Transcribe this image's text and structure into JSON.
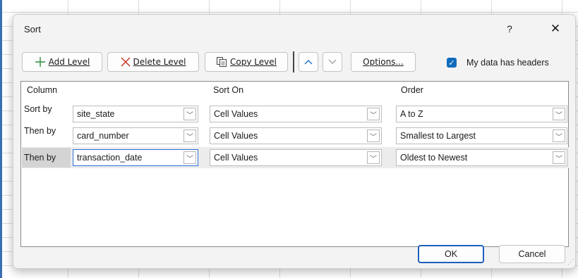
{
  "dialog": {
    "title": "Sort",
    "help_label": "?",
    "close_label": "✕"
  },
  "toolbar": {
    "add_level": "Add Level",
    "delete_level": "Delete Level",
    "copy_level": "Copy Level",
    "move_up_icon": "chevron-up",
    "move_down_icon": "chevron-down",
    "options": "Options...",
    "headers_checkbox": {
      "label": "My data has headers",
      "checked": true
    }
  },
  "columns": {
    "column": "Column",
    "sort_on": "Sort On",
    "order": "Order"
  },
  "rows": [
    {
      "label": "Sort by",
      "column": "site_state",
      "sort_on": "Cell Values",
      "order": "A to Z"
    },
    {
      "label": "Then by",
      "column": "card_number",
      "sort_on": "Cell Values",
      "order": "Smallest to Largest"
    },
    {
      "label": "Then by",
      "column": "transaction_date",
      "sort_on": "Cell Values",
      "order": "Oldest to Newest"
    }
  ],
  "footer": {
    "ok": "OK",
    "cancel": "Cancel"
  },
  "colors": {
    "accent": "#0f6cbd",
    "ok_border": "#1f5fbf",
    "selected_row": "#d4d4d4"
  }
}
